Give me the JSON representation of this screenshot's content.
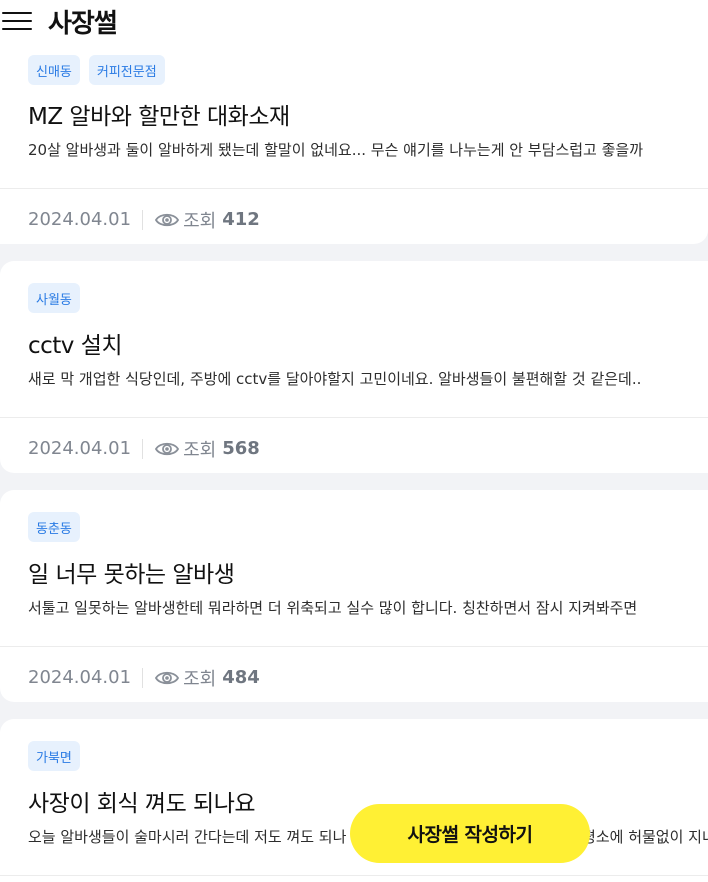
{
  "header": {
    "title": "사장썰"
  },
  "posts": [
    {
      "tags": [
        "신매동",
        "커피전문점"
      ],
      "title": "MZ 알바와 할만한 대화소재",
      "snippet": "20살 알바생과 둘이 알바하게 됐는데 할말이 없네요... 무슨 얘기를 나누는게 안 부담스럽고 좋을까",
      "date": "2024.04.01",
      "views_label": "조회",
      "views": "412"
    },
    {
      "tags": [
        "사월동"
      ],
      "title": "cctv 설치",
      "snippet": "새로 막 개업한 식당인데, 주방에 cctv를 달아야할지 고민이네요. 알바생들이 불편해할 것 같은데..",
      "date": "2024.04.01",
      "views_label": "조회",
      "views": "568"
    },
    {
      "tags": [
        "동춘동"
      ],
      "title": "일 너무 못하는 알바생",
      "snippet": "서툴고 일못하는 알바생한테 뭐라하면 더 위축되고 실수 많이 합니다. 칭찬하면서 잠시 지켜봐주면",
      "date": "2024.04.01",
      "views_label": "조회",
      "views": "484"
    },
    {
      "tags": [
        "가북면"
      ],
      "title": "사장이 회식 껴도 되나요",
      "snippet": "오늘 알바생들이 술마시러 간다는데 저도 껴도 되나 싶어서요 다같이 편하게 놀고 싶은데 평소에 허물없이 지내",
      "date": "",
      "views_label": "",
      "views": ""
    }
  ],
  "fab": {
    "label": "사장썰 작성하기"
  },
  "colors": {
    "tag_bg": "#e7f1fd",
    "tag_text": "#2a7be4",
    "fab": "#fff034",
    "background": "#f2f3f6"
  },
  "icons": {
    "menu": "hamburger-menu-icon",
    "views": "eye-icon"
  }
}
